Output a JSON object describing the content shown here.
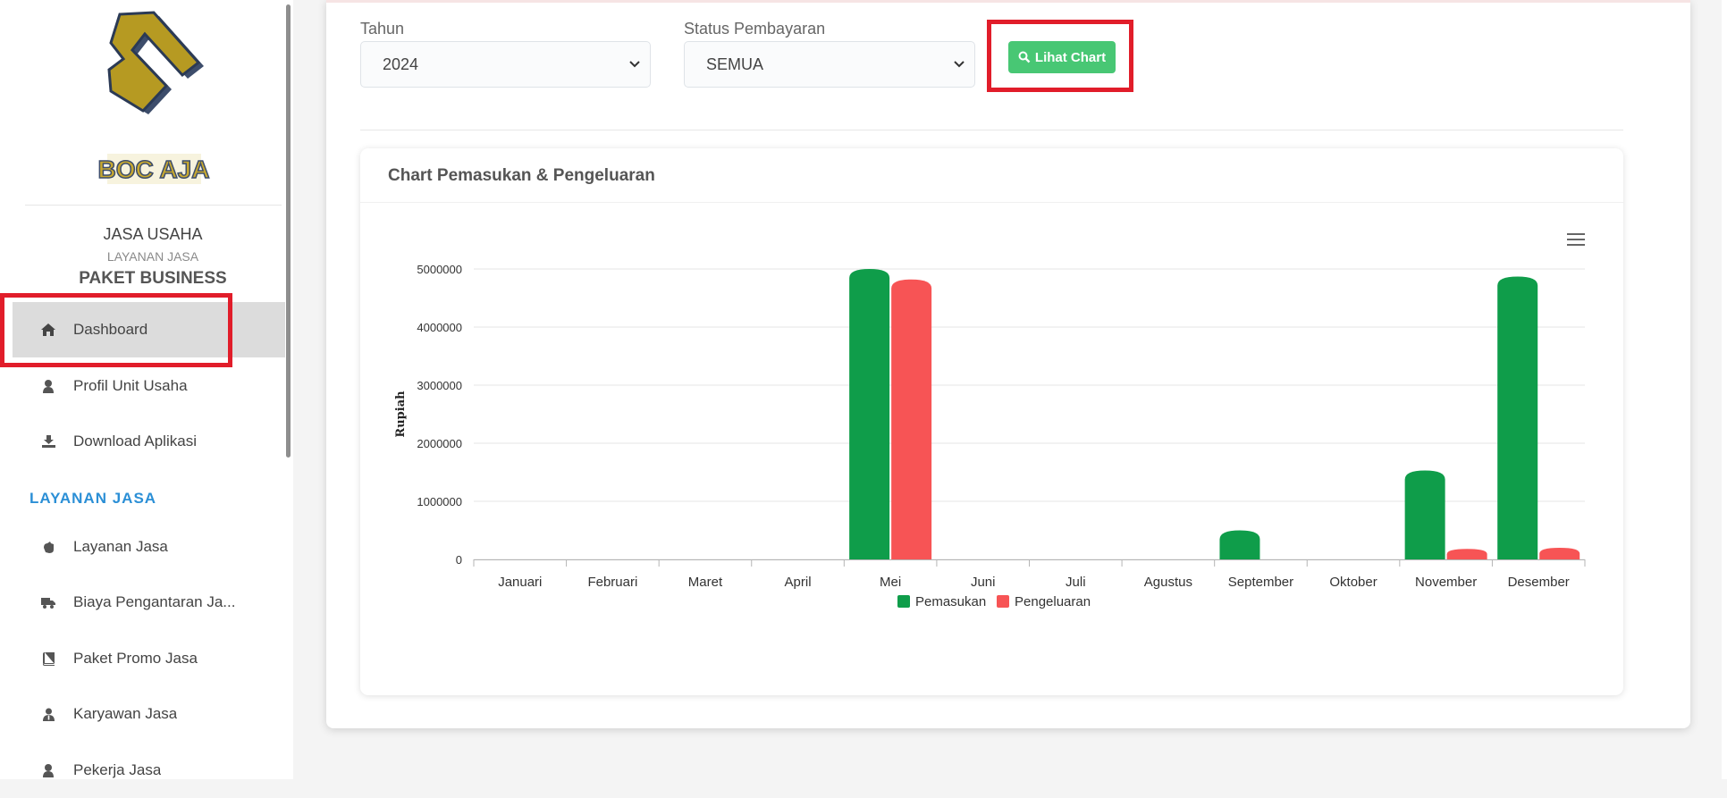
{
  "sidebar": {
    "business_name": "JASA USAHA",
    "business_type": "LAYANAN JASA",
    "plan": "PAKET BUSINESS",
    "logo_text": "BOC AJA",
    "items": [
      {
        "label": "Dashboard",
        "icon": "home-icon"
      },
      {
        "label": "Profil Unit Usaha",
        "icon": "user-icon"
      },
      {
        "label": "Download Aplikasi",
        "icon": "download-icon"
      }
    ],
    "section_title": "LAYANAN JASA",
    "section_items": [
      {
        "label": "Layanan Jasa",
        "icon": "hand-icon"
      },
      {
        "label": "Biaya Pengantaran Ja...",
        "icon": "truck-icon"
      },
      {
        "label": "Paket Promo Jasa",
        "icon": "book-icon"
      },
      {
        "label": "Karyawan Jasa",
        "icon": "user-tie-icon"
      },
      {
        "label": "Pekerja Jasa",
        "icon": "user-icon"
      }
    ]
  },
  "filters": {
    "year_label": "Tahun",
    "year_value": "2024",
    "status_label": "Status Pembayaran",
    "status_value": "SEMUA",
    "button_label": "Lihat Chart"
  },
  "chart_card": {
    "title": "Chart Pemasukan & Pengeluaran"
  },
  "colors": {
    "income": "#0f9d4a",
    "expense": "#f75455",
    "accent_button": "#48c774",
    "highlight": "#e11d2a",
    "section_title": "#2b8fd6"
  },
  "chart_data": {
    "type": "bar",
    "title": "",
    "xlabel": "",
    "ylabel": "Rupiah",
    "ylim": [
      0,
      5000000
    ],
    "yticks": [
      "0",
      "1000000",
      "2000000",
      "3000000",
      "4000000",
      "5000000"
    ],
    "categories": [
      "Januari",
      "Februari",
      "Maret",
      "April",
      "Mei",
      "Juni",
      "Juli",
      "Agustus",
      "September",
      "Oktober",
      "November",
      "Desember"
    ],
    "series": [
      {
        "name": "Pemasukan",
        "color": "#0f9d4a",
        "values": [
          0,
          0,
          0,
          0,
          5000000,
          0,
          0,
          0,
          500000,
          0,
          1530000,
          4870000
        ]
      },
      {
        "name": "Pengeluaran",
        "color": "#f75455",
        "values": [
          0,
          0,
          0,
          0,
          4820000,
          0,
          0,
          0,
          0,
          0,
          180000,
          200000
        ]
      }
    ],
    "grid": true,
    "legend_position": "bottom"
  }
}
